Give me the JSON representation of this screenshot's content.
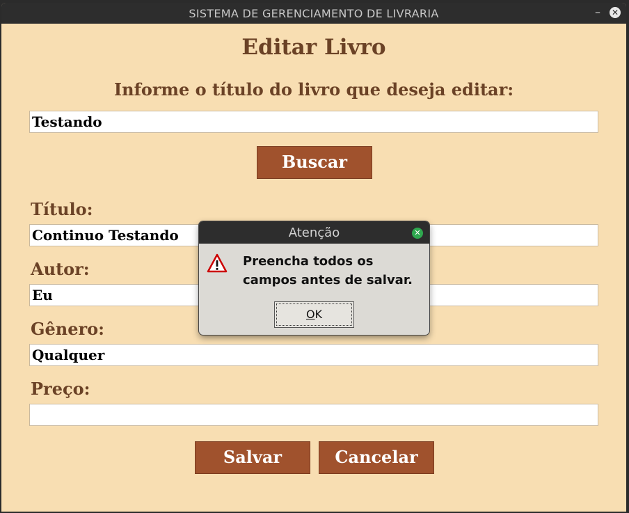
{
  "window": {
    "title": "SISTEMA DE GERENCIAMENTO DE LIVRARIA",
    "minimize_glyph": "–",
    "close_glyph": "✕"
  },
  "form": {
    "heading": "Editar Livro",
    "search_prompt": "Informe o título do livro que deseja editar:",
    "search_value": "Testando",
    "search_button": "Buscar",
    "fields": {
      "titulo": {
        "label": "Título:",
        "value": "Continuo Testando"
      },
      "autor": {
        "label": "Autor:",
        "value": "Eu"
      },
      "genero": {
        "label": "Gênero:",
        "value": "Qualquer"
      },
      "preco": {
        "label": "Preço:",
        "value": ""
      }
    },
    "save_button": "Salvar",
    "cancel_button": "Cancelar"
  },
  "dialog": {
    "title": "Atenção",
    "message": "Preencha todos os campos antes de salvar.",
    "ok_mnemonic": "O",
    "ok_rest": "K",
    "icon": "warning-icon",
    "close_glyph": "✕"
  },
  "colors": {
    "background": "#f8deb2",
    "text_brown": "#6b4226",
    "button": "#a0522d",
    "titlebar": "#2d2d2d",
    "dialog_bg": "#dcdad5",
    "warning_red": "#cc0000"
  }
}
